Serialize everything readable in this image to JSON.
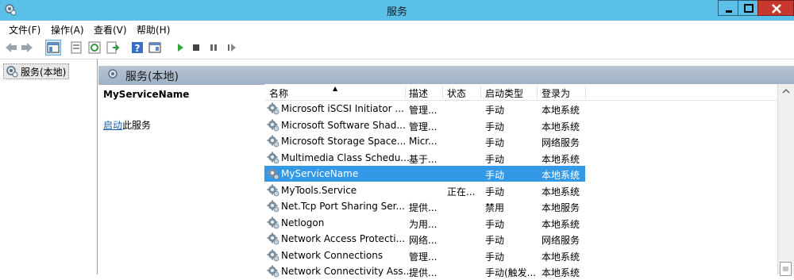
{
  "window": {
    "title": "服务"
  },
  "menu": {
    "items": [
      {
        "label": "文件(F)"
      },
      {
        "label": "操作(A)"
      },
      {
        "label": "查看(V)"
      },
      {
        "label": "帮助(H)"
      }
    ]
  },
  "tree": {
    "item_label": "服务(本地)"
  },
  "pane": {
    "title": "服务(本地)"
  },
  "detail": {
    "service_name": "MyServiceName",
    "start_link": "启动",
    "start_suffix": "此服务"
  },
  "list": {
    "columns": [
      "名称",
      "描述",
      "状态",
      "启动类型",
      "登录为"
    ],
    "rows": [
      {
        "name": "Microsoft iSCSI Initiator ...",
        "desc": "管理...",
        "status": "",
        "startup": "手动",
        "logon": "本地系统"
      },
      {
        "name": "Microsoft Software Shad...",
        "desc": "管理...",
        "status": "",
        "startup": "手动",
        "logon": "本地系统"
      },
      {
        "name": "Microsoft Storage Space...",
        "desc": "Micr...",
        "status": "",
        "startup": "手动",
        "logon": "网络服务"
      },
      {
        "name": "Multimedia Class Schedu...",
        "desc": "基于...",
        "status": "",
        "startup": "手动",
        "logon": "本地系统"
      },
      {
        "name": "MyServiceName",
        "desc": "",
        "status": "",
        "startup": "手动",
        "logon": "本地系统",
        "selected": true
      },
      {
        "name": "MyTools.Service",
        "desc": "",
        "status": "正在...",
        "startup": "手动",
        "logon": "本地系统"
      },
      {
        "name": "Net.Tcp Port Sharing Ser...",
        "desc": "提供...",
        "status": "",
        "startup": "禁用",
        "logon": "本地服务"
      },
      {
        "name": "Netlogon",
        "desc": "为用...",
        "status": "",
        "startup": "手动",
        "logon": "本地系统"
      },
      {
        "name": "Network Access Protecti...",
        "desc": "网络...",
        "status": "",
        "startup": "手动",
        "logon": "网络服务"
      },
      {
        "name": "Network Connections",
        "desc": "管理...",
        "status": "",
        "startup": "手动",
        "logon": "本地系统"
      },
      {
        "name": "Network Connectivity Ass...",
        "desc": "提供...",
        "status": "",
        "startup": "手动(触发...",
        "logon": "本地系统"
      }
    ]
  },
  "colors": {
    "titlebar": "#5bc0e8",
    "selection": "#3399e6",
    "close_button": "#c7382f",
    "link": "#1f5fa8"
  },
  "icons": [
    "services-icon",
    "back-icon",
    "forward-icon",
    "show-hide-tree-icon",
    "properties-icon",
    "refresh-icon",
    "export-list-icon",
    "help-icon",
    "view-icon",
    "start-service-icon",
    "stop-service-icon",
    "pause-service-icon",
    "restart-service-icon",
    "gear-icon"
  ]
}
